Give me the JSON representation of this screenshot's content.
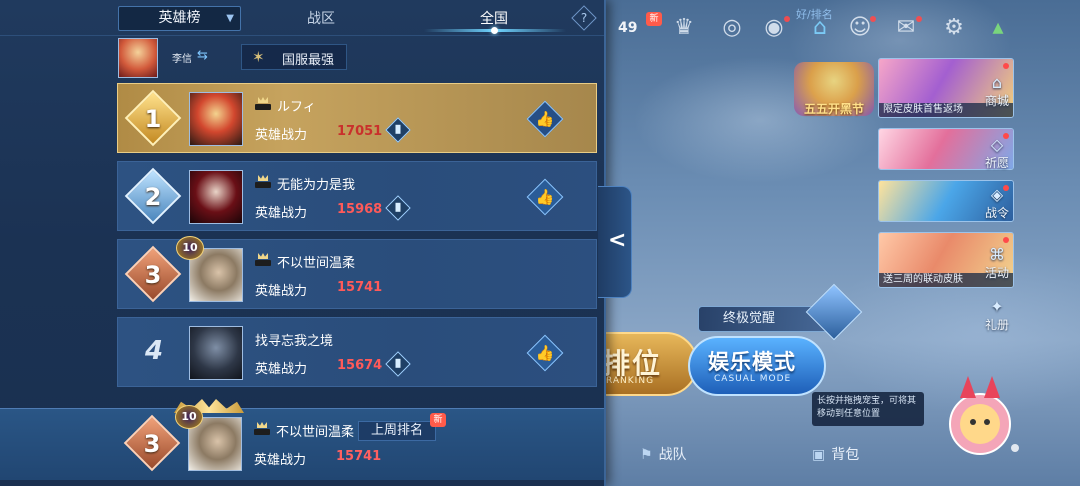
{
  "tabs": {
    "dropdown_label": "英雄榜",
    "region_label": "战区",
    "all_label": "全国",
    "help_label": "?"
  },
  "hero": {
    "name": "李信",
    "region_badge": "国服最强"
  },
  "rankings": [
    {
      "rank": "1",
      "name": "ルフィ",
      "power_label": "英雄战力",
      "power": "17051"
    },
    {
      "rank": "2",
      "name": "无能为力是我",
      "power_label": "英雄战力",
      "power": "15968"
    },
    {
      "rank": "3",
      "name": "不以世间温柔",
      "power_label": "英雄战力",
      "power": "15741",
      "level": "10"
    },
    {
      "rank": "4",
      "name": "找寻忘我之境",
      "power_label": "英雄战力",
      "power": "15674"
    }
  ],
  "my_rank": {
    "rank": "3",
    "name": "不以世间温柔",
    "level": "10",
    "last_week_label": "上周排名",
    "new_tag": "新",
    "power_label": "英雄战力",
    "power": "15741"
  },
  "lobby": {
    "gem_count": "49",
    "gem_new": "新",
    "top_partial": "好/排名",
    "festival_label": "五五开黑节",
    "shop_cards": [
      {
        "caption": "限定皮肤首售返场",
        "label": "商城"
      },
      {
        "caption": "",
        "label": "祈愿"
      },
      {
        "caption": "",
        "label": "战令"
      },
      {
        "caption": "送三周的联动皮肤",
        "label": "活动"
      }
    ],
    "gift_label": "礼册",
    "awakening_label": "终极觉醒",
    "ranked_label": "排位",
    "ranked_sub": "RANKING",
    "casual_label": "娱乐模式",
    "casual_sub": "CASUAL MODE",
    "hint_text": "长按并拖拽宠宝，可将其移动到任意位置",
    "nav_team": "战队",
    "nav_bag": "背包"
  },
  "colors": {
    "panel_bg": "#1b3253",
    "gold_row": "#c6a35e",
    "row_blue": "#2d5282",
    "power_red": "#ff5a59",
    "accent": "#6fd4ff"
  }
}
